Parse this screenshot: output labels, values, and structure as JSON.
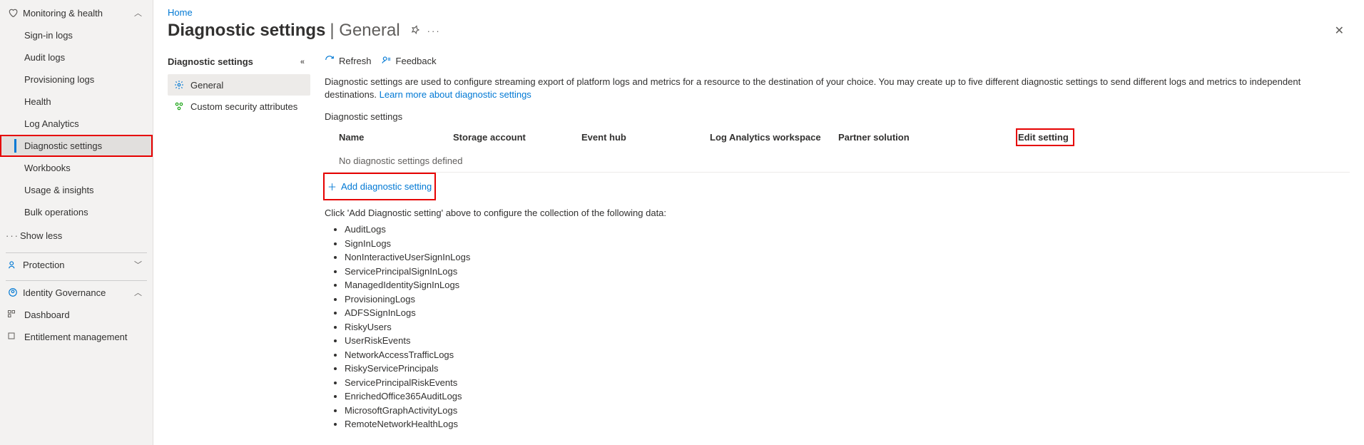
{
  "breadcrumb": {
    "home": "Home"
  },
  "title": {
    "main": "Diagnostic settings",
    "sub": "General"
  },
  "sidebar": {
    "group_monitoring": "Monitoring & health",
    "items_monitoring": [
      {
        "label": "Sign-in logs"
      },
      {
        "label": "Audit logs"
      },
      {
        "label": "Provisioning logs"
      },
      {
        "label": "Health"
      },
      {
        "label": "Log Analytics"
      },
      {
        "label": "Diagnostic settings"
      },
      {
        "label": "Workbooks"
      },
      {
        "label": "Usage & insights"
      },
      {
        "label": "Bulk operations"
      }
    ],
    "show_less": "Show less",
    "group_protection": "Protection",
    "group_identity": "Identity Governance",
    "items_identity": [
      {
        "label": "Dashboard"
      },
      {
        "label": "Entitlement management"
      }
    ]
  },
  "secondnav": {
    "header": "Diagnostic settings",
    "items": [
      {
        "label": "General"
      },
      {
        "label": "Custom security attributes"
      }
    ]
  },
  "toolbar": {
    "refresh": "Refresh",
    "feedback": "Feedback"
  },
  "description": {
    "text": "Diagnostic settings are used to configure streaming export of platform logs and metrics for a resource to the destination of your choice. You may create up to five different diagnostic settings to send different logs and metrics to independent destinations. ",
    "link": "Learn more about diagnostic settings"
  },
  "section_label": "Diagnostic settings",
  "table": {
    "headers": {
      "name": "Name",
      "storage": "Storage account",
      "eventhub": "Event hub",
      "law": "Log Analytics workspace",
      "partner": "Partner solution",
      "edit": "Edit setting"
    },
    "empty_label": "No diagnostic settings defined",
    "add_label": "Add diagnostic setting"
  },
  "instruction": "Click 'Add Diagnostic setting' above to configure the collection of the following data:",
  "data_types": [
    "AuditLogs",
    "SignInLogs",
    "NonInteractiveUserSignInLogs",
    "ServicePrincipalSignInLogs",
    "ManagedIdentitySignInLogs",
    "ProvisioningLogs",
    "ADFSSignInLogs",
    "RiskyUsers",
    "UserRiskEvents",
    "NetworkAccessTrafficLogs",
    "RiskyServicePrincipals",
    "ServicePrincipalRiskEvents",
    "EnrichedOffice365AuditLogs",
    "MicrosoftGraphActivityLogs",
    "RemoteNetworkHealthLogs"
  ]
}
